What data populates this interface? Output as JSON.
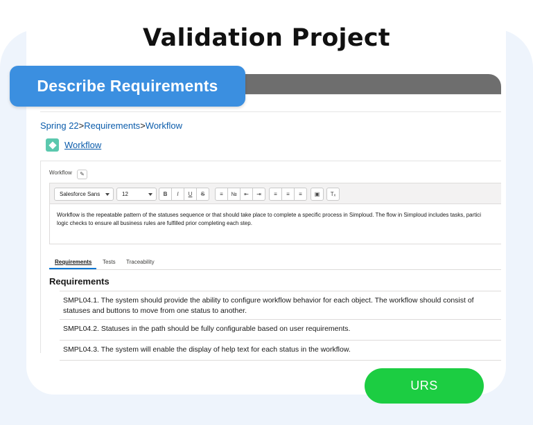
{
  "title": "Validation Project",
  "banner": {
    "label": "Describe Requirements"
  },
  "breadcrumb": {
    "items": [
      "Spring 22",
      "Requirements",
      "Workflow"
    ],
    "separator": ">"
  },
  "record": {
    "name": "Workflow"
  },
  "field": {
    "label": "Workflow"
  },
  "toolbar": {
    "font_family": "Salesforce Sans",
    "font_size": "12",
    "buttons": [
      "B",
      "I",
      "U",
      "S",
      "bulleted-list-icon",
      "numbered-list-icon",
      "indent-decrease-icon",
      "indent-increase-icon",
      "align-left-icon",
      "align-center-icon",
      "align-right-icon",
      "image-icon",
      "clear-format-icon"
    ]
  },
  "editor": {
    "line1": "Workflow is the repeatable pattern of the statuses sequence or that should take place to complete a specific process in Simploud. The flow in Simploud includes tasks, partici",
    "line2": "logic checks to ensure all business rules are fulfilled prior completing each step."
  },
  "tabs": [
    {
      "label": "Requirements",
      "active": true
    },
    {
      "label": "Tests",
      "active": false
    },
    {
      "label": "Traceability",
      "active": false
    }
  ],
  "requirements": {
    "heading": "Requirements",
    "items": [
      "SMPL04.1. The system should provide the ability to configure workflow behavior for each object. The workflow should consist of statuses and buttons to move from one status to another.",
      "SMPL04.2. Statuses in the path should be fully configurable based on user requirements.",
      "SMPL04.3. The system will enable the display of help text for each status in the workflow."
    ]
  },
  "urs_button": {
    "label": "URS"
  },
  "colors": {
    "blue_pill": "#3b8fe0",
    "green_pill": "#1ccd42",
    "link": "#0b5cab",
    "record_icon": "#5bc8ae",
    "bar": "#6e6e6e"
  }
}
